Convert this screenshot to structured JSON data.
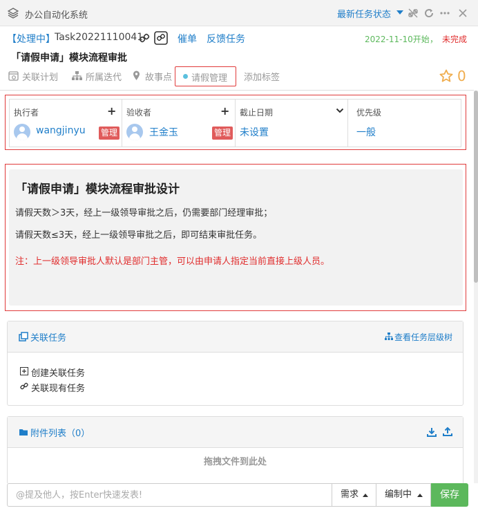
{
  "titlebar": {
    "app_title": "办公自动化系统",
    "status_menu": "最新任务状态"
  },
  "task": {
    "status_tag": "【处理中】",
    "task_id": "Task20221110041",
    "action_assign": "催单",
    "action_feedback": "反馈任务",
    "start_date": "2022-11-10开始",
    "comma": "，",
    "completion": "未完成",
    "title": "「请假申请」模块流程审批",
    "star_count": "0"
  },
  "meta": {
    "plan": "关联计划",
    "iteration": "所属迭代",
    "story": "故事点",
    "module": "请假管理",
    "add_tag": "添加标签"
  },
  "people": {
    "executor_label": "执行者",
    "executor_name": "wangjinyu",
    "acceptor_label": "验收者",
    "acceptor_name": "王金玉",
    "admin_badge": "管理",
    "deadline_label": "截止日期",
    "deadline_value": "未设置",
    "priority_label": "优先级",
    "priority_value": "一般"
  },
  "description": {
    "heading": "「请假申请」模块流程审批设计",
    "line1": "请假天数＞3天，经上一级领导审批之后，仍需要部门经理审批；",
    "line2": "请假天数≤3天，经上一级领导审批之后，即可结束审批任务。",
    "note": "注：上一级领导审批人默认是部门主管，可以由申请人指定当前直接上级人员。"
  },
  "related": {
    "title": "关联任务",
    "view_tree": "查看任务层级树",
    "create": "创建关联任务",
    "link_existing": "关联现有任务"
  },
  "attachments": {
    "title": "附件列表（0）",
    "drop_hint": "拖拽文件到此处"
  },
  "comment": {
    "placeholder": "@提及他人，按Enter快速发表!",
    "type_dropdown": "需求",
    "state_dropdown": "编制中",
    "save": "保存"
  },
  "colors": {
    "link_blue": "#1f7ec9",
    "alert_red": "#e02d2d",
    "success_green": "#5cb85c",
    "star_gold": "#f0ad4e"
  }
}
